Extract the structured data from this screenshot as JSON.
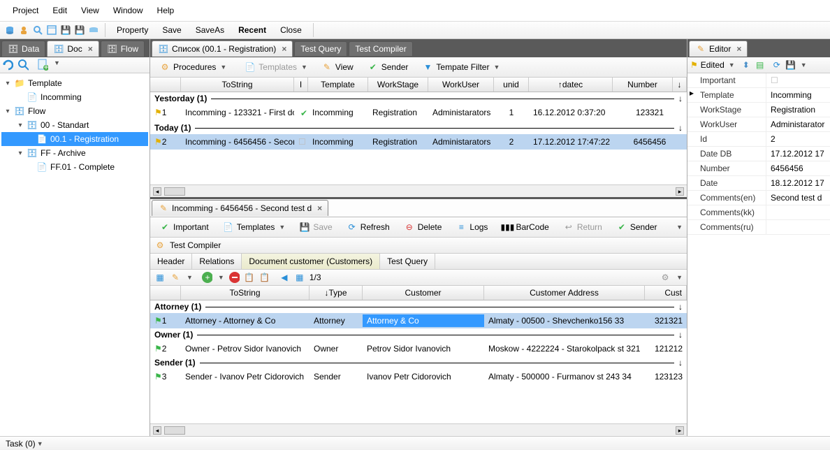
{
  "menu": {
    "project": "Project",
    "edit": "Edit",
    "view": "View",
    "window": "Window",
    "help": "Help"
  },
  "toolbar": {
    "property": "Property",
    "save": "Save",
    "saveas": "SaveAs",
    "recent": "Recent",
    "close": "Close"
  },
  "leftTabs": {
    "data": "Data",
    "doc": "Doc",
    "flow": "Flow"
  },
  "tree": {
    "template": "Template",
    "incomming": "Incomming",
    "flow": "Flow",
    "standart": "00 - Standart",
    "registration": "00.1 - Registration",
    "archive": "FF - Archive",
    "complete": "FF.01 - Complete"
  },
  "centerTabs": {
    "list": "Список (00.1 - Registration)",
    "testQuery": "Test Query",
    "testCompiler": "Test Compiler"
  },
  "listTb": {
    "procedures": "Procedures",
    "templates": "Templates",
    "view": "View",
    "sender": "Sender",
    "filter": "Tempate Filter"
  },
  "gridCols": {
    "tostring": "ToString",
    "i": "I",
    "template": "Template",
    "workstage": "WorkStage",
    "workuser": "WorkUser",
    "unid": "unid",
    "datec": "datec",
    "number": "Number"
  },
  "groups": {
    "yesterday": "Yestorday (1)",
    "today": "Today (1)"
  },
  "rows": {
    "r1": {
      "n": "1",
      "ts": "Incomming - 123321 - First do",
      "tpl": "Incomming",
      "ws": "Registration",
      "wu": "Administarators",
      "unid": "1",
      "datec": "16.12.2012 0:37:20",
      "num": "123321"
    },
    "r2": {
      "n": "2",
      "ts": "Incomming - 6456456 - Secon",
      "tpl": "Incomming",
      "ws": "Registration",
      "wu": "Administarators",
      "unid": "2",
      "datec": "17.12.2012 17:47:22",
      "num": "6456456"
    }
  },
  "detailTab": "Incomming - 6456456 - Second test d",
  "detailTb": {
    "important": "Important",
    "templates": "Templates",
    "save": "Save",
    "refresh": "Refresh",
    "delete": "Delete",
    "logs": "Logs",
    "barcode": "BarCode",
    "return": "Return",
    "sender": "Sender"
  },
  "testCompiler": "Test Compiler",
  "innerTabs": {
    "header": "Header",
    "relations": "Relations",
    "doccust": "Document customer (Customers)",
    "testQuery": "Test Query"
  },
  "pager": "1/3",
  "custCols": {
    "tostring": "ToString",
    "type": "Type",
    "customer": "Customer",
    "addr": "Customer Address",
    "custn": "Cust"
  },
  "custGroups": {
    "attorney": "Attorney (1)",
    "owner": "Owner (1)",
    "sender": "Sender (1)"
  },
  "custRows": {
    "c1": {
      "n": "1",
      "ts": "Attorney - Attorney & Co",
      "type": "Attorney",
      "cust": "Attorney & Co",
      "addr": "Almaty - 00500 - Shevchenko156 33",
      "cn": "321321"
    },
    "c2": {
      "n": "2",
      "ts": "Owner - Petrov Sidor Ivanovich",
      "type": "Owner",
      "cust": "Petrov Sidor Ivanovich",
      "addr": "Moskow - 4222224 - Starokolpack st 321",
      "cn": "121212"
    },
    "c3": {
      "n": "3",
      "ts": "Sender - Ivanov Petr Cidorovich",
      "type": "Sender",
      "cust": "Ivanov Petr Cidorovich",
      "addr": "Almaty - 500000 - Furmanov st 243 34",
      "cn": "123123"
    }
  },
  "editor": {
    "title": "Editor",
    "edited": "Edited",
    "props": {
      "important": {
        "k": "Important",
        "v": ""
      },
      "template": {
        "k": "Template",
        "v": "Incomming"
      },
      "workstage": {
        "k": "WorkStage",
        "v": "Registration"
      },
      "workuser": {
        "k": "WorkUser",
        "v": "Administarator"
      },
      "id": {
        "k": "Id",
        "v": "2"
      },
      "datedb": {
        "k": "Date DB",
        "v": "17.12.2012 17"
      },
      "number": {
        "k": "Number",
        "v": "6456456"
      },
      "date": {
        "k": "Date",
        "v": "18.12.2012 17"
      },
      "cen": {
        "k": "Comments(en)",
        "v": "Second test d"
      },
      "ckk": {
        "k": "Comments(kk)",
        "v": ""
      },
      "cru": {
        "k": "Comments(ru)",
        "v": ""
      }
    }
  },
  "status": "Task (0)"
}
